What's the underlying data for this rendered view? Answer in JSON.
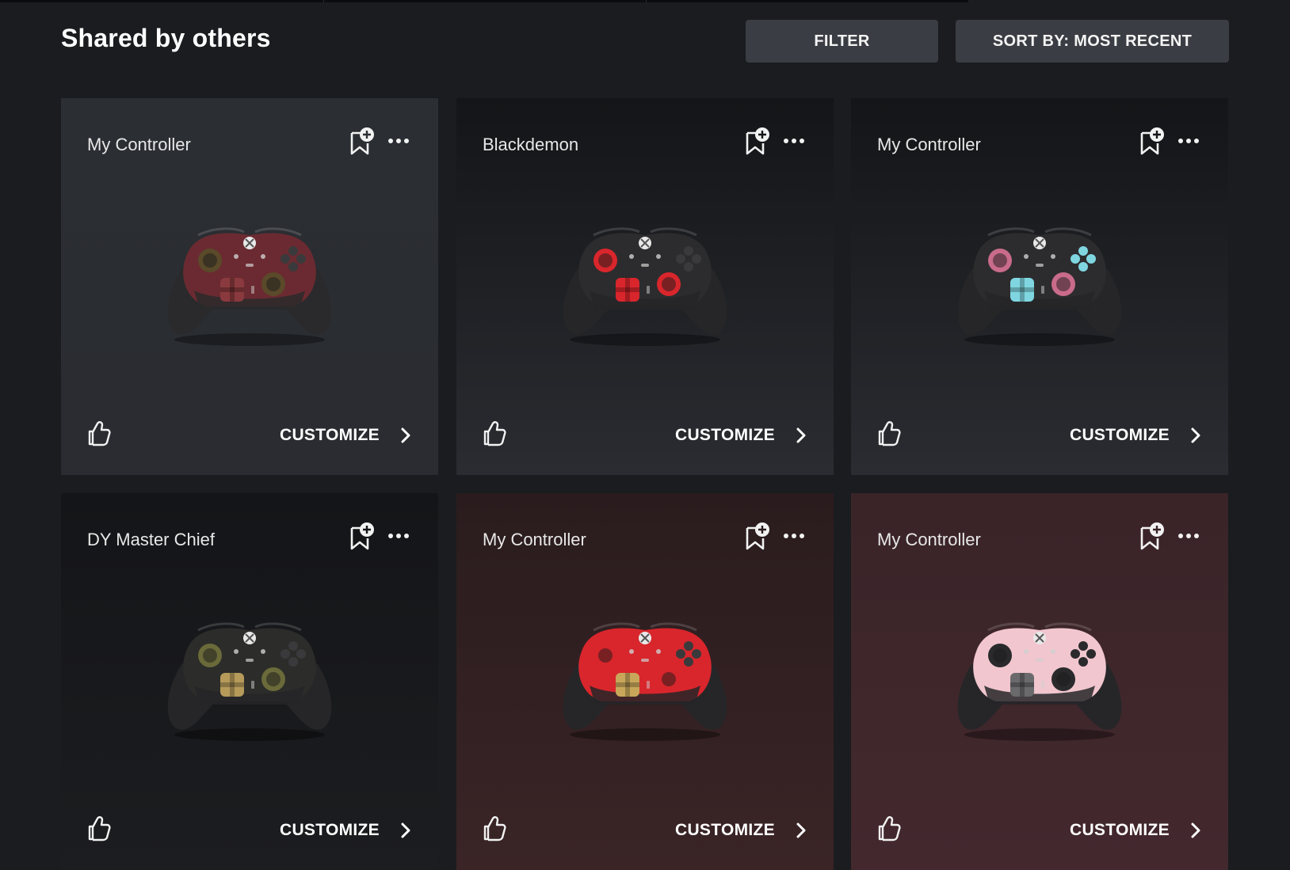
{
  "page": {
    "title": "Shared by others"
  },
  "toolbar": {
    "filter_label": "FILTER",
    "sort_label": "SORT BY: MOST RECENT"
  },
  "cards": [
    {
      "name": "My Controller",
      "customize_label": "CUSTOMIZE",
      "bg_top": "#2b2e33",
      "bg_bottom": "#2a2c31",
      "controller": {
        "top": "#6b2a31",
        "body": "#2a2a2c",
        "stick": "#5a4a2a",
        "dpad": "#8a3a3e",
        "btn": "#3a3a3c"
      }
    },
    {
      "name": "Blackdemon",
      "customize_label": "CUSTOMIZE",
      "bg_top": "#141518",
      "bg_bottom": "#2a2c31",
      "controller": {
        "top": "#2c2c2e",
        "body": "#262628",
        "stick": "#d8262c",
        "dpad": "#d8262c",
        "btn": "#3a3a3c"
      }
    },
    {
      "name": "My Controller",
      "customize_label": "CUSTOMIZE",
      "bg_top": "#141518",
      "bg_bottom": "#2a2c31",
      "controller": {
        "top": "#2c2c2e",
        "body": "#262628",
        "stick": "#c96b8a",
        "dpad": "#7fd6e0",
        "btn": "#7fd6e0"
      }
    },
    {
      "name": "DY Master Chief",
      "customize_label": "CUSTOMIZE",
      "bg_top": "#141518",
      "bg_bottom": "#1c1d20",
      "controller": {
        "top": "#2c2c2a",
        "body": "#262628",
        "stick": "#6a6a3a",
        "dpad": "#b59a5a",
        "btn": "#3a3a3c"
      }
    },
    {
      "name": "My Controller",
      "customize_label": "CUSTOMIZE",
      "bg_top": "#2a1c1e",
      "bg_bottom": "#3a2426",
      "controller": {
        "top": "#d8262c",
        "body": "#262628",
        "stick": "#d8262c",
        "dpad": "#c9a75a",
        "btn": "#3a3a3c"
      }
    },
    {
      "name": "My Controller",
      "customize_label": "CUSTOMIZE",
      "bg_top": "#3a2428",
      "bg_bottom": "#43292e",
      "controller": {
        "top": "#f1c6cf",
        "body": "#262628",
        "stick": "#2a2a2c",
        "dpad": "#6a6a6c",
        "btn": "#2a2a2c"
      }
    }
  ]
}
